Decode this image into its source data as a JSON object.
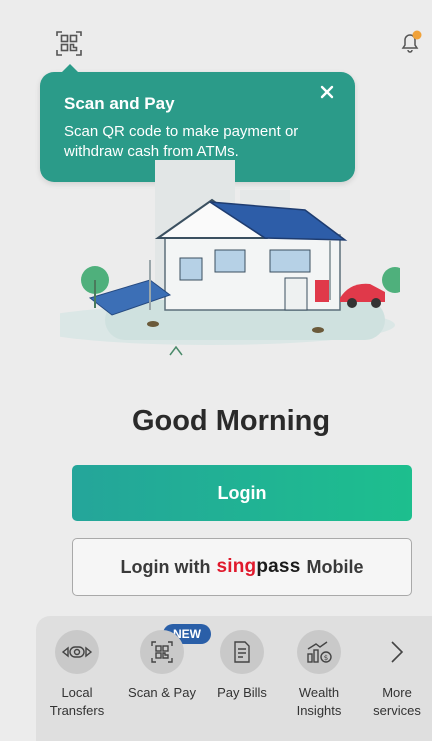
{
  "tooltip": {
    "title": "Scan and Pay",
    "body": "Scan QR code to make payment or withdraw cash from ATMs."
  },
  "greeting": "Good Morning",
  "buttons": {
    "login": "Login",
    "singpass_prefix": "Login with",
    "singpass_brand_a": "sing",
    "singpass_brand_b": "pass",
    "singpass_suffix": "Mobile"
  },
  "quick_actions": [
    {
      "label_1": "Local",
      "label_2": "Transfers",
      "icon": "transfer-icon"
    },
    {
      "label_1": "Scan & Pay",
      "label_2": "",
      "icon": "qr-scan-icon",
      "badge": "NEW"
    },
    {
      "label_1": "Pay Bills",
      "label_2": "",
      "icon": "bill-icon"
    },
    {
      "label_1": "Wealth",
      "label_2": "Insights",
      "icon": "wealth-chart-icon"
    },
    {
      "label_1": "More",
      "label_2": "services",
      "icon": "chevron-right-icon"
    }
  ],
  "colors": {
    "accent": "#2b9b89",
    "login_gradient_start": "#24a59a",
    "login_gradient_end": "#1dbf8e",
    "badge": "#2a5fa8",
    "singpass_red": "#e0192c",
    "notification_dot": "#f0a23a"
  }
}
